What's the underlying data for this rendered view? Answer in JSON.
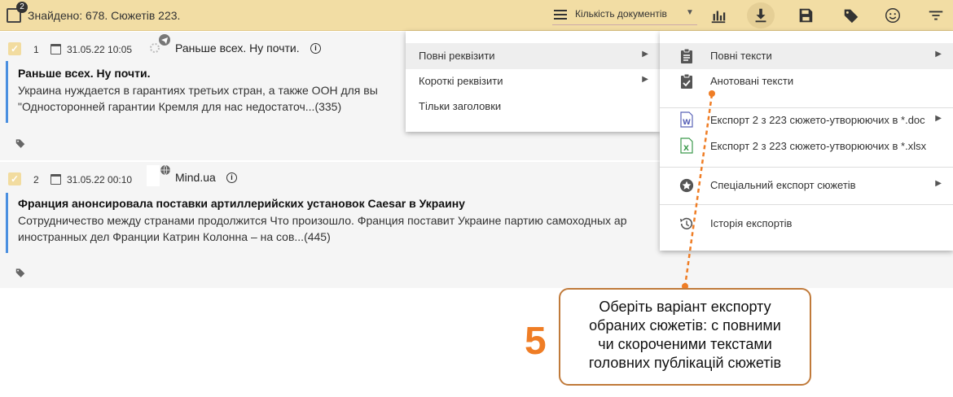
{
  "toolbar": {
    "selected_count": "2",
    "found_text": "Знайдено: 678. Сюжетів 223.",
    "sort_label": "Кількість документів"
  },
  "items": [
    {
      "index": "1",
      "date": "31.05.22 10:05",
      "source": "Раньше всех. Ну почти.",
      "title": "Раньше всех. Ну почти.",
      "snippet_line1": "Украина нуждается в гарантиях третьих стран, а также ООН для вы",
      "snippet_line2": "\"Односторонней гарантии Кремля для нас недостаточ...(335)"
    },
    {
      "index": "2",
      "date": "31.05.22 00:10",
      "source": "Mind.ua",
      "title": "Франция анонсировала поставки артиллерийских установок Caesar в Украину",
      "snippet_line1": "Сотрудничество между странами продолжится Что произошло. Франция поставит Украине партию самоходных ар",
      "snippet_line2": "иностранных дел Франции Катрин Колонна – на сов...(445)"
    }
  ],
  "menu_level1": {
    "items": [
      "Повні реквізити",
      "Короткі реквізити",
      "Тільки заголовки"
    ]
  },
  "menu_level2": {
    "full_texts": "Повні тексти",
    "annotated_texts": "Анотовані тексти",
    "export_doc": "Експорт 2 з 223 сюжето-утворюючих в *.doc",
    "export_xlsx": "Експорт 2 з 223 сюжето-утворюючих в *.xlsx",
    "special_export": "Спеціальний експорт сюжетів",
    "export_history": "Історія експортів"
  },
  "callout": {
    "step": "5",
    "line1": "Оберіть варіант експорту",
    "line2": "обраних сюжетів: с повними",
    "line3": "чи скороченими текстами",
    "line4": "головних публікацій сюжетів"
  },
  "colors": {
    "toolbar_bg": "#f2dda4",
    "accent_bar": "#4a8fe0",
    "callout_orange": "#ef7d25"
  }
}
